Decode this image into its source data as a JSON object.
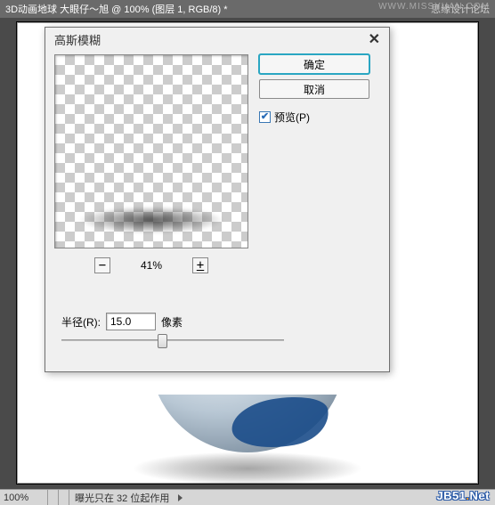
{
  "titlebar": {
    "left": "3D动画地球   大眼仔～旭 @ 100% (图层 1, RGB/8) *",
    "right": "思缘设计论坛"
  },
  "dialog": {
    "title": "高斯模糊",
    "close": "✕",
    "ok_label": "确定",
    "cancel_label": "取消",
    "preview_label": "预览(P)",
    "zoom_minus": "−",
    "zoom_value": "41%",
    "zoom_plus": "+",
    "radius_label": "半径(R):",
    "radius_value": "15.0",
    "radius_unit": "像素"
  },
  "statusbar": {
    "zoom": "100%",
    "info": "曝光只在 32 位起作用"
  },
  "watermark": {
    "top": "WWW.MISSYUAN.COM",
    "text_pre": "JB51",
    "dot": ".",
    "text_post": "Net"
  }
}
